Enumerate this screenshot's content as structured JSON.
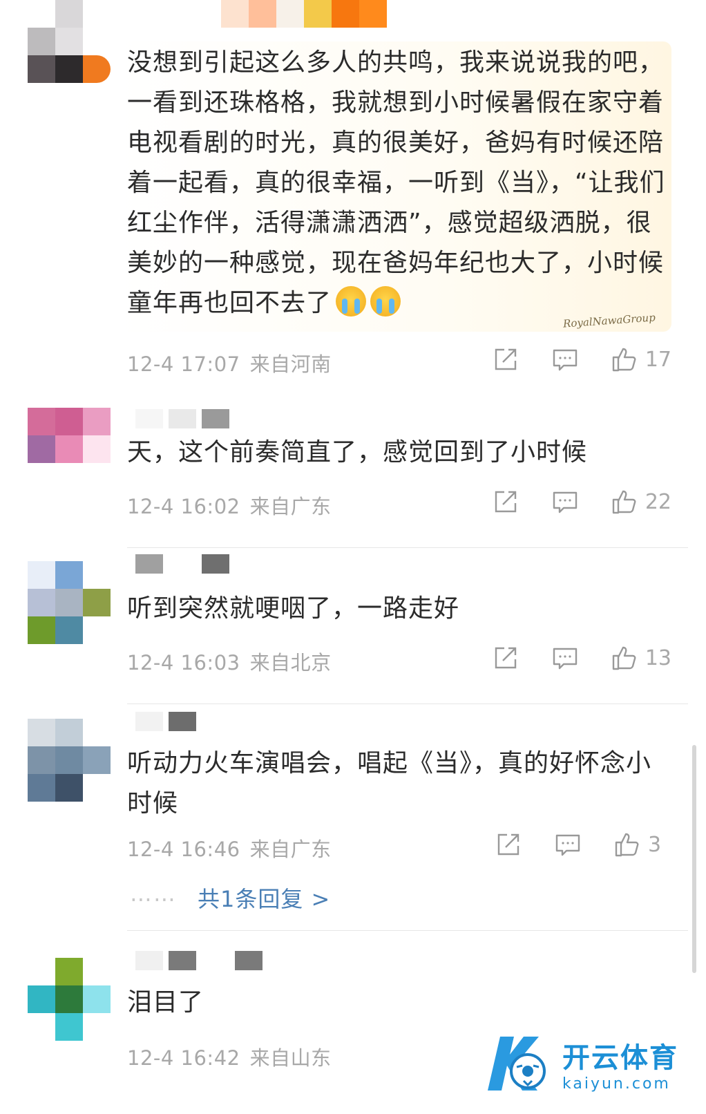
{
  "comments": [
    {
      "text": "没想到引起这么多人的共鸣，我来说说我的吧，一看到还珠格格，我就想到小时候暑假在家守着电视看剧的时光，真的很美好，爸妈有时候还陪着一起看，真的很幸福，一听到《当》，“让我们红尘作伴，活得潇潇洒洒”，感觉超级洒脱，很美妙的一种感觉，现在爸妈年纪也大了，小时候童年再也回不去了",
      "time": "12-4 17:07",
      "location": "来自河南",
      "likes": "17"
    },
    {
      "text": "天，这个前奏简直了，感觉回到了小时候",
      "time": "12-4 16:02",
      "location": "来自广东",
      "likes": "22"
    },
    {
      "text": "听到突然就哽咽了，一路走好",
      "time": "12-4 16:03",
      "location": "来自北京",
      "likes": "13"
    },
    {
      "text": "听动力火车演唱会，唱起《当》，真的好怀念小时候",
      "time": "12-4 16:46",
      "location": "来自广东",
      "likes": "3",
      "reply_link": "共1条回复 >",
      "reply_dots": "⋯⋯"
    },
    {
      "text": "泪目了",
      "time": "12-4 16:42",
      "location": "来自山东"
    }
  ],
  "watermark": {
    "cn": "开云体育",
    "en": "kaiyun.com"
  },
  "signature": "RoyalNawaGroup",
  "colors": {
    "link": "#4a7fb5",
    "meta": "#a8a8a8",
    "text": "#2b2b2b",
    "brand": "#1c8fd6"
  },
  "icons": [
    "share-icon",
    "comment-icon",
    "like-icon",
    "crying-emoji-icon"
  ]
}
